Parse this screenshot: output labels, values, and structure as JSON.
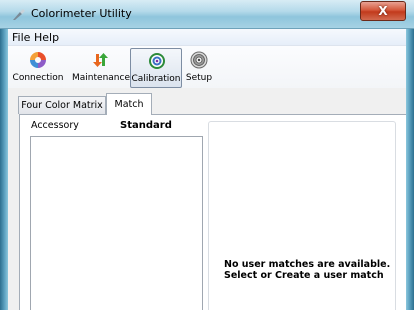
{
  "window": {
    "title": "Colorimeter Utility",
    "close_glyph": "X"
  },
  "menu": {
    "items": [
      {
        "label": "File"
      },
      {
        "label": "Help"
      }
    ]
  },
  "toolbar": {
    "items": [
      {
        "label": "Connection",
        "icon": "connection-icon"
      },
      {
        "label": "Maintenance",
        "icon": "maintenance-arrows-icon"
      },
      {
        "label": "Calibration",
        "icon": "calibration-target-icon",
        "selected": true
      },
      {
        "label": "Setup",
        "icon": "setup-gear-icon"
      }
    ]
  },
  "tabs": [
    {
      "label": "Four Color Matrix",
      "active": false
    },
    {
      "label": "Match",
      "active": true
    }
  ],
  "match": {
    "accessory_label": "Accessory",
    "standard_label": "Standard",
    "message_line1": "No user matches are available.",
    "message_line2": "Select or Create a user match"
  },
  "colors": {
    "titlebar": "#b5daea",
    "close_button": "#c23a1c",
    "selected_tool_border": "#7d8da3"
  }
}
